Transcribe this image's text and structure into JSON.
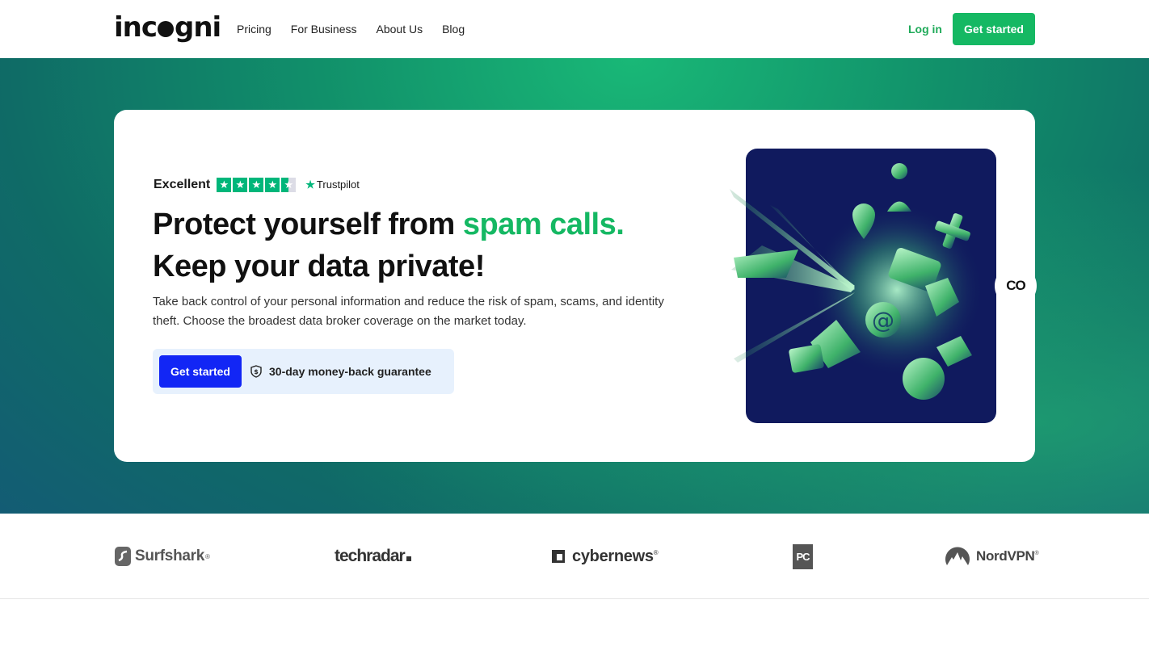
{
  "header": {
    "logo_text": "incogni",
    "nav": [
      "Pricing",
      "For Business",
      "About Us",
      "Blog"
    ],
    "login": "Log in",
    "get_started": "Get started"
  },
  "hero": {
    "rating_label": "Excellent",
    "rating_stars": 4.5,
    "trustpilot": "Trustpilot",
    "headline_part1": "Protect yourself from ",
    "headline_highlight": "spam calls.",
    "headline_line2": "Keep your data private!",
    "subtext": "Take back control of your personal information and reduce the risk of spam, scams, and identity theft. Choose the broadest data broker coverage on the market today.",
    "cta": "Get started",
    "guarantee": "30-day money-back guarantee",
    "side_button": "CO"
  },
  "press": {
    "logos": [
      "Surfshark",
      "techradar",
      "cybernews",
      "PC",
      "NordVPN"
    ]
  },
  "colors": {
    "brand_green": "#15b863",
    "cta_blue": "#1226f5",
    "illustration_bg": "#101a5e"
  }
}
